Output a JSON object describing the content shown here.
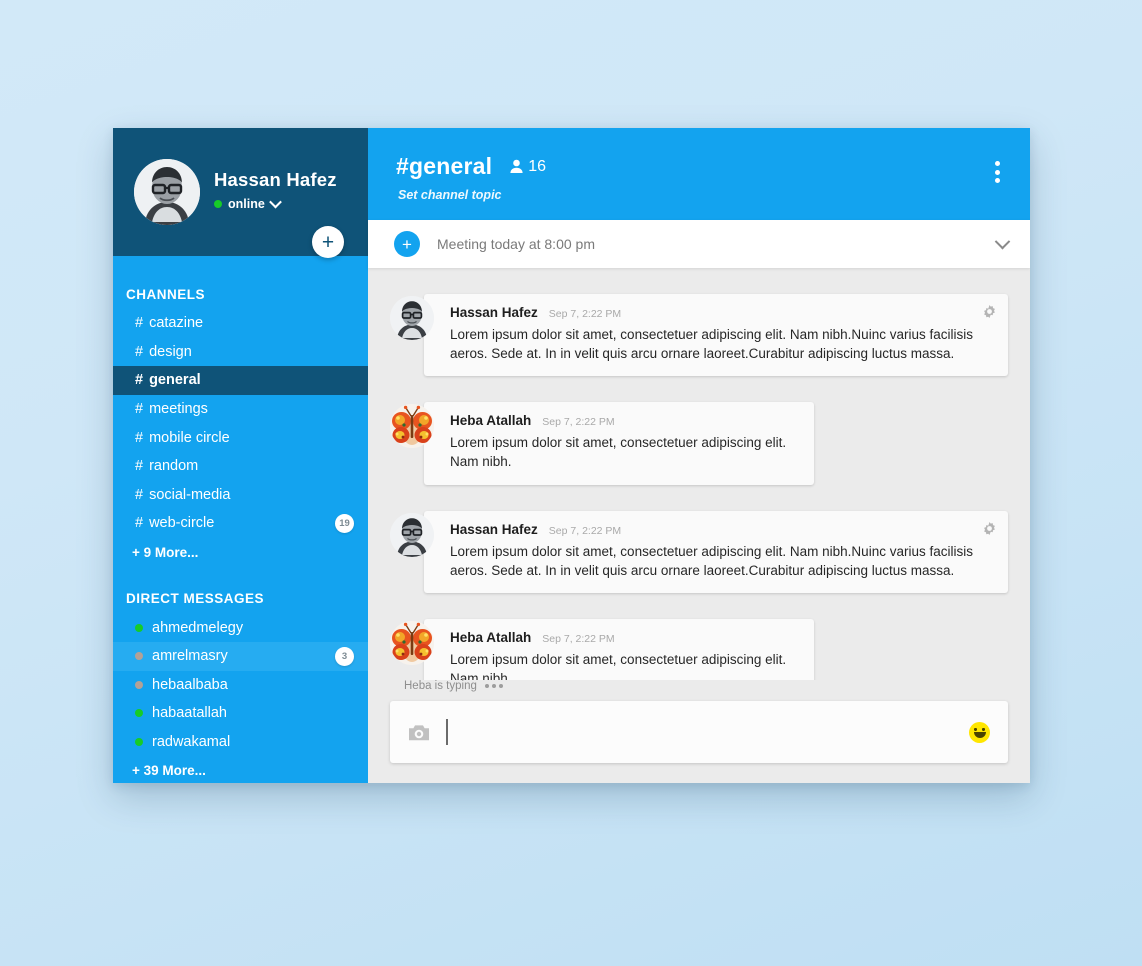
{
  "profile": {
    "name": "Hassan Hafez",
    "status_label": "online",
    "status_color": "#17cc28",
    "avatar": "user-photo-avatar"
  },
  "sidebar": {
    "add_button_label": "+",
    "channels_heading": "CHANNELS",
    "channels": [
      {
        "hash": "#",
        "label": "catazine",
        "badge": "",
        "state": "normal"
      },
      {
        "hash": "#",
        "label": "design",
        "badge": "",
        "state": "normal"
      },
      {
        "hash": "#",
        "label": "general",
        "badge": "",
        "state": "active"
      },
      {
        "hash": "#",
        "label": "meetings",
        "badge": "",
        "state": "normal"
      },
      {
        "hash": "#",
        "label": "mobile circle",
        "badge": "",
        "state": "normal"
      },
      {
        "hash": "#",
        "label": "random",
        "badge": "",
        "state": "normal"
      },
      {
        "hash": "#",
        "label": "social-media",
        "badge": "",
        "state": "normal"
      },
      {
        "hash": "#",
        "label": "web-circle",
        "badge": "19",
        "state": "normal"
      }
    ],
    "channels_more": "+ 9 More...",
    "dms_heading": "DIRECT MESSAGES",
    "dms": [
      {
        "label": "ahmedmelegy",
        "presence": "online",
        "badge": "",
        "state": "normal"
      },
      {
        "label": "amrelmasry",
        "presence": "away",
        "badge": "3",
        "state": "hover"
      },
      {
        "label": "hebaalbaba",
        "presence": "away",
        "badge": "",
        "state": "normal"
      },
      {
        "label": "habaatallah",
        "presence": "online",
        "badge": "",
        "state": "normal"
      },
      {
        "label": "radwakamal",
        "presence": "online",
        "badge": "",
        "state": "normal"
      }
    ],
    "dms_more": "+ 39 More...",
    "colors": {
      "background": "#13a3ef",
      "active": "#0f5378",
      "hover": "#26acf1"
    }
  },
  "header": {
    "channel_name": "#general",
    "member_count": "16",
    "topic": "Set channel topic",
    "menu_icon": "more-vertical-icon",
    "background": "#13a3ef"
  },
  "pinned": {
    "add_label": "+",
    "text": "Meeting today at 8:00 pm",
    "chevron_icon": "chevron-down-icon"
  },
  "messages": [
    {
      "author": "Hassan Hafez",
      "time": "Sep 7, 2:22 PM",
      "text": "Lorem ipsum dolor sit amet, consectetuer adipiscing elit. Nam nibh.Nuinc varius facilisis aeros. Sede at. In in velit quis arcu ornare laoreet.Curabitur adipiscing luctus massa.",
      "avatar": "user-photo-avatar",
      "width": "wide",
      "has_gear": true
    },
    {
      "author": "Heba Atallah",
      "time": "Sep 7, 2:22 PM",
      "text": "Lorem ipsum dolor sit amet, consectetuer adipiscing elit. Nam nibh.",
      "avatar": "butterfly-avatar",
      "width": "narrow",
      "has_gear": false
    },
    {
      "author": "Hassan Hafez",
      "time": "Sep 7, 2:22 PM",
      "text": "Lorem ipsum dolor sit amet, consectetuer adipiscing elit. Nam nibh.Nuinc varius facilisis aeros. Sede at. In in velit quis arcu ornare laoreet.Curabitur adipiscing luctus massa.",
      "avatar": "user-photo-avatar",
      "width": "wide",
      "has_gear": true
    },
    {
      "author": "Heba Atallah",
      "time": "Sep 7, 2:22 PM",
      "text": "Lorem ipsum dolor sit amet, consectetuer adipiscing elit. Nam nibh.",
      "avatar": "butterfly-avatar",
      "width": "narrow",
      "has_gear": false
    }
  ],
  "composer": {
    "typing_text": "Heba is typing",
    "input_value": "",
    "placeholder": "",
    "camera_icon": "camera-icon",
    "emoji_icon": "smiley-face-icon"
  }
}
